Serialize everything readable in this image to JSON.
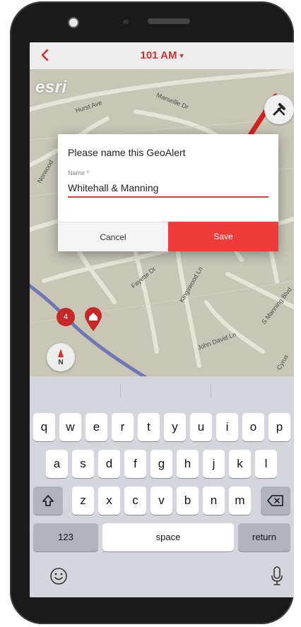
{
  "nav": {
    "back_icon": "chevron-left-icon",
    "title": "101 AM",
    "caret": "▾"
  },
  "map": {
    "logo": "esri",
    "streets": [
      "Hurst Ave",
      "Marseille Dr",
      "Norwood",
      "Fayette Dr",
      "Kingswood Ln",
      "John David Ln",
      "S Manning Blvd",
      "Cyrus"
    ],
    "cluster_count": "4",
    "compass_label": "N"
  },
  "dialog": {
    "title": "Please name this GeoAlert",
    "name_label": "Name *",
    "name_value": "Whitehall & Manning",
    "cancel_label": "Cancel",
    "save_label": "Save"
  },
  "keyboard": {
    "row1": [
      "q",
      "w",
      "e",
      "r",
      "t",
      "y",
      "u",
      "i",
      "o",
      "p"
    ],
    "row2": [
      "a",
      "s",
      "d",
      "f",
      "g",
      "h",
      "j",
      "k",
      "l"
    ],
    "row3": [
      "z",
      "x",
      "c",
      "v",
      "b",
      "n",
      "m"
    ],
    "numbers_label": "123",
    "space_label": "space",
    "return_label": "return"
  },
  "colors": {
    "accent": "#d32f2f",
    "save_button": "#f03b3b"
  }
}
